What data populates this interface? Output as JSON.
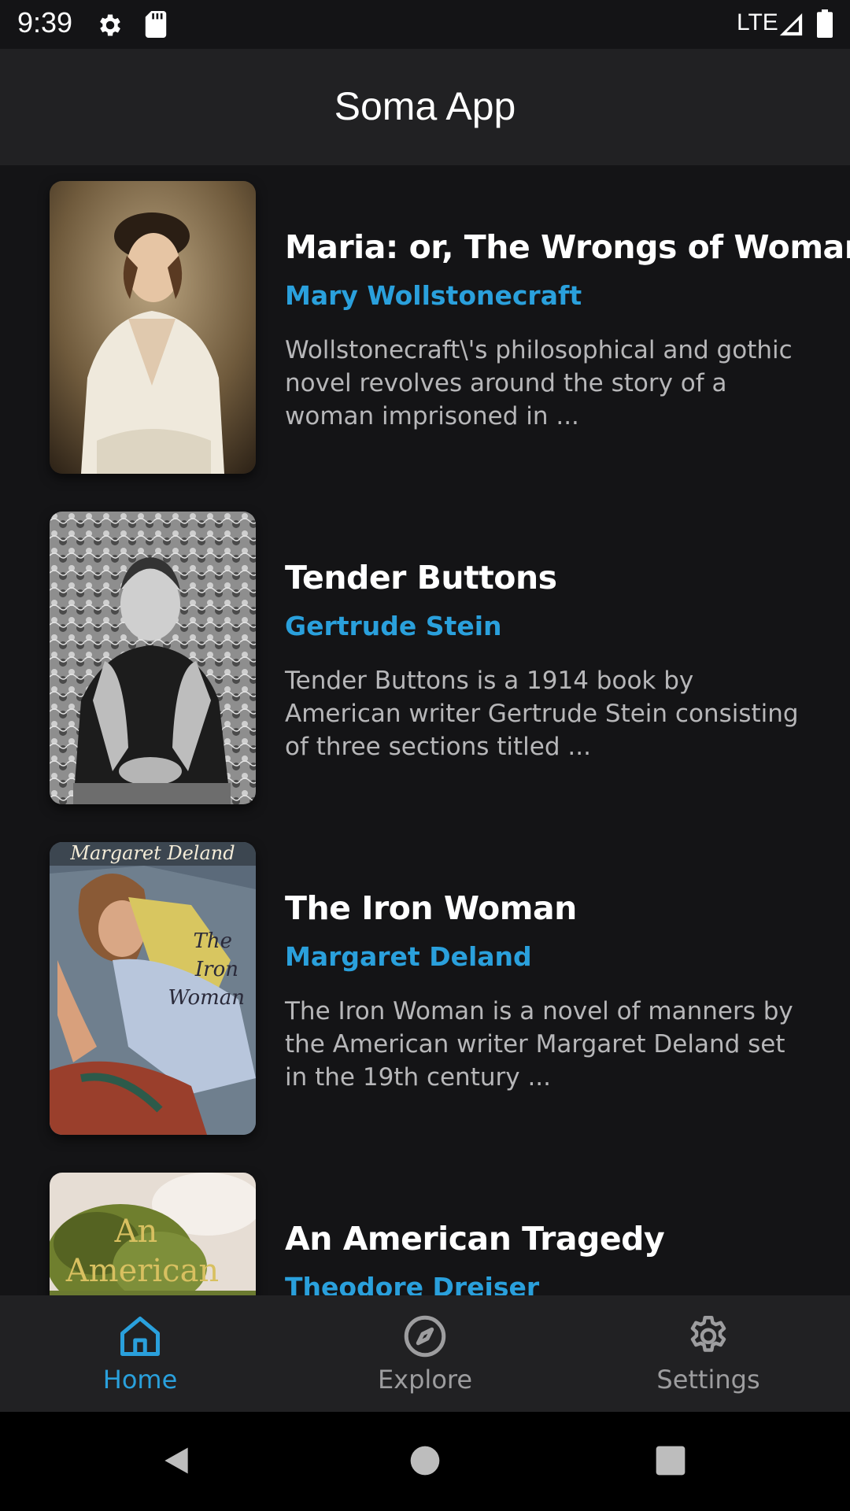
{
  "status_bar": {
    "time": "9:39",
    "network": "LTE"
  },
  "app": {
    "title": "Soma App"
  },
  "books": [
    {
      "title": "Maria: or, The Wrongs of Woman",
      "author": "Mary Wollstonecraft",
      "description": "Wollstonecraft\\'s philosophical and gothic novel revolves around the story of a woman imprisoned in ..."
    },
    {
      "title": "Tender Buttons",
      "author": "Gertrude Stein",
      "description": "Tender Buttons is a 1914 book by American writer Gertrude Stein consisting of three sections titled ..."
    },
    {
      "title": "The Iron Woman",
      "author": "Margaret Deland",
      "description": "The Iron Woman is a novel of manners by the American writer Margaret Deland set in the 19th century ...",
      "cover_text": {
        "top": "Margaret Deland",
        "line1": "The",
        "line2": "Iron",
        "line3": "Woman"
      }
    },
    {
      "title": "An American Tragedy",
      "author": "Theodore Dreiser",
      "cover_text": {
        "line1": "An",
        "line2": "American"
      }
    }
  ],
  "bottom_nav": {
    "items": [
      {
        "label": "Home",
        "icon": "home-icon",
        "active": true
      },
      {
        "label": "Explore",
        "icon": "compass-icon",
        "active": false
      },
      {
        "label": "Settings",
        "icon": "gear-icon",
        "active": false
      }
    ]
  },
  "colors": {
    "accent": "#2aa0dc",
    "background": "#141416",
    "bar": "#212123",
    "inactive": "#9d9d9f"
  }
}
